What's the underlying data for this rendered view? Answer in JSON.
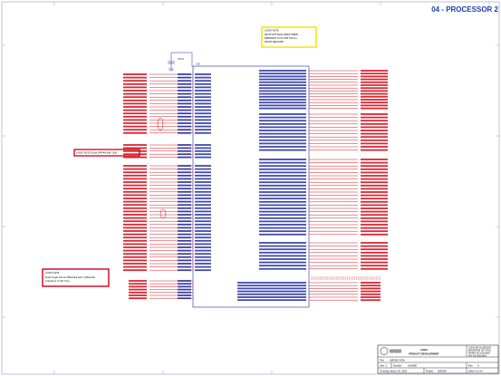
{
  "sheet_title": "04 - PROCESSOR 2",
  "notes": {
    "note_top": {
      "title": "LAYOUT NOTE",
      "lines": [
        "ROUTE DIFF PAIRS SINGLE ENDED",
        "IMPEDANCE TO 50 OHM FOR ALL",
        "TRACES INDICATED"
      ]
    },
    "note_left": {
      "text": "LAYOUT NOTE: Route DIFFPAIR with 100R"
    },
    "note_bottom": {
      "title": "LAYOUT NOTE",
      "lines": [
        "Route ringed nets as differential pairs. Differential",
        "impedance of 100 ohms"
      ]
    }
  },
  "chip": {
    "label": "U1B",
    "power_label": "VDDIO"
  },
  "title_block": {
    "company": "LOGIC",
    "dept": "PRODUCT DEVELOPMENT",
    "title_label": "Title",
    "title_value": "AM335X SOM",
    "size_label": "Size",
    "size_value": "C",
    "number_label": "Number",
    "number_value": "1014650",
    "rev_label": "Rev",
    "rev_value": "A",
    "date_label": "Thursday, March 25, 2010",
    "sheet_label": "Project",
    "sheet_value": "AM335X",
    "sheet_of": "Sheet 4 of 14",
    "address_lines": [
      "10200 SW ALLEN BLVD",
      "BEAVERTON OR 97005",
      "PHONE 503-626-6600",
      "FAX 503-626-6601"
    ]
  },
  "colors": {
    "net": "#d4000f",
    "wire": "#1f2a9e",
    "highlight_note": "#f5e51c",
    "red_box": "#d0001a",
    "title": "#1a3fb0"
  }
}
